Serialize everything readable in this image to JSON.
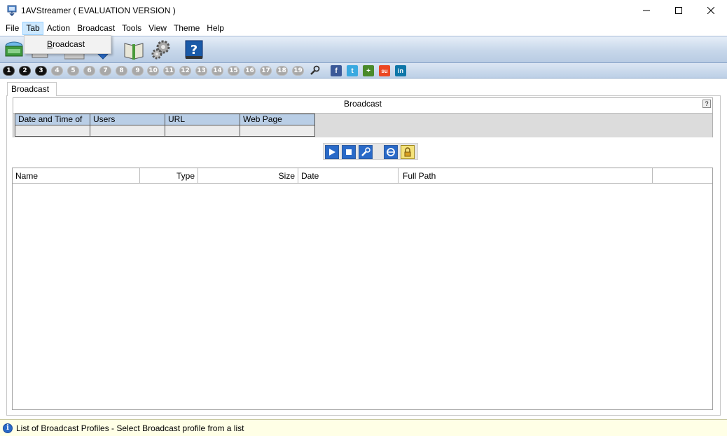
{
  "window": {
    "title": "1AVStreamer ( EVALUATION VERSION )",
    "app_icon": "monitor-stream-icon",
    "controls": [
      "minimize-icon",
      "maximize-icon",
      "close-icon"
    ]
  },
  "menubar": {
    "items": [
      "File",
      "Tab",
      "Action",
      "Broadcast",
      "Tools",
      "View",
      "Theme",
      "Help"
    ],
    "active": "Tab"
  },
  "dropdown": {
    "items": [
      "Broadcast"
    ]
  },
  "toolbar": {
    "icons": [
      "tray-icon",
      "server-icon",
      "document-icon",
      "download-icon",
      "book-icon",
      "gears-icon",
      "help-book-icon"
    ]
  },
  "numbar": {
    "tabs": [
      "1",
      "2",
      "3",
      "4",
      "5",
      "6",
      "7",
      "8",
      "9",
      "10",
      "11",
      "12",
      "13",
      "14",
      "15",
      "16",
      "17",
      "18",
      "19"
    ],
    "active_count": 3,
    "tool_icon": "wrench-icon",
    "social": [
      {
        "name": "facebook-icon",
        "glyph": "f",
        "color": "#3b5998"
      },
      {
        "name": "twitter-icon",
        "glyph": "t",
        "color": "#39a9e0"
      },
      {
        "name": "googleplus-icon",
        "glyph": "+",
        "color": "#4a8a2a"
      },
      {
        "name": "stumbleupon-icon",
        "glyph": "su",
        "color": "#eb4823"
      },
      {
        "name": "linkedin-icon",
        "glyph": "in",
        "color": "#0e76a8"
      }
    ]
  },
  "tab": {
    "label": "Broadcast"
  },
  "broadcast_panel": {
    "title": "Broadcast",
    "help": "?",
    "columns": [
      "Date and Time of",
      "Users",
      "URL",
      "Web Page"
    ]
  },
  "controls": {
    "buttons": [
      "play-icon",
      "stop-icon",
      "settings-wrench-icon",
      "browser-icon",
      "lock-icon"
    ]
  },
  "file_list": {
    "columns": [
      "Name",
      "Type",
      "Size",
      "Date",
      "Full Path"
    ],
    "rows": []
  },
  "status": {
    "icon": "info-icon",
    "text": "List of Broadcast Profiles - Select Broadcast profile from a list"
  }
}
